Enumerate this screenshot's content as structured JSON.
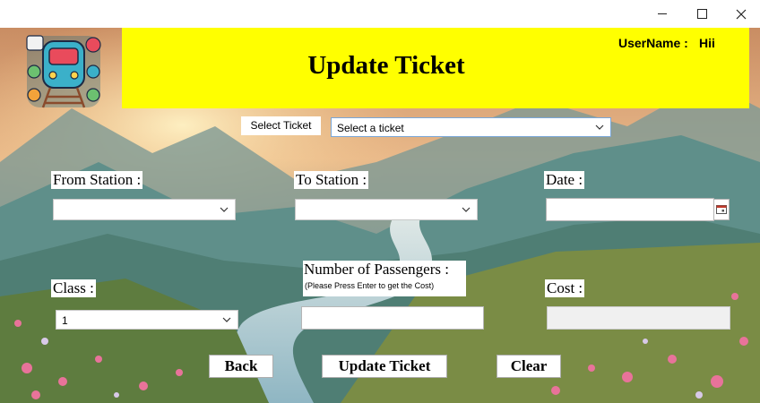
{
  "window": {
    "minimize_icon": "minimize-icon",
    "maximize_icon": "maximize-icon",
    "close_icon": "close-icon"
  },
  "colors": {
    "banner": "#ffff00",
    "sky": "#e9b98a",
    "mountains": "#5f8f8a",
    "meadow": "#6f8a3e",
    "flowers": "#e8739a"
  },
  "header": {
    "title": "Update Ticket",
    "username_label": "UserName :",
    "username_value": "Hii",
    "logo_icon": "train-app-logo-icon"
  },
  "select_ticket": {
    "label": "Select Ticket",
    "value": "Select a ticket"
  },
  "form": {
    "from_station_label": "From Station :",
    "from_station_value": "",
    "to_station_label": "To Station :",
    "to_station_value": "",
    "date_label": "Date :",
    "date_value": "",
    "class_label": "Class :",
    "class_value": "1",
    "passengers_label": "Number of Passengers :",
    "passengers_hint": "(Please Press Enter to get the Cost)",
    "passengers_value": "",
    "cost_label": "Cost :",
    "cost_value": ""
  },
  "buttons": {
    "back": "Back",
    "update": "Update Ticket",
    "clear": "Clear"
  }
}
